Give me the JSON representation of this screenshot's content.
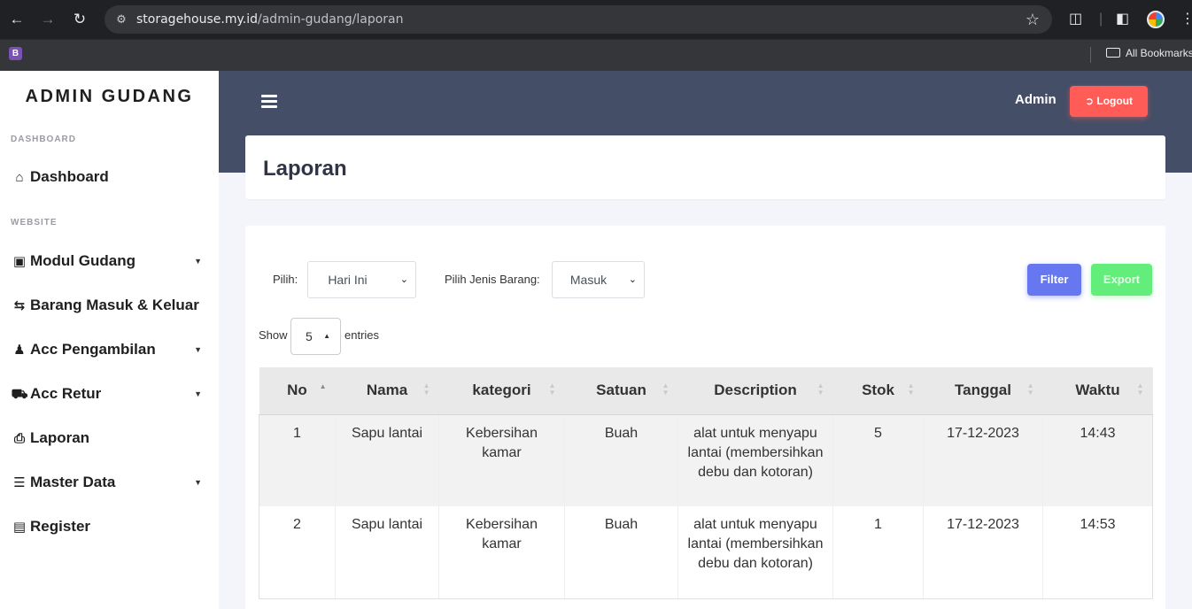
{
  "browser": {
    "url_host": "storagehouse.my.id",
    "url_path": "/admin-gudang/laporan",
    "bookmarks_label": "All Bookmarks",
    "favicon_letter": "B"
  },
  "sidebar": {
    "brand": "ADMIN GUDANG",
    "sections": {
      "dashboard": "DASHBOARD",
      "website": "WEBSITE"
    },
    "items": [
      {
        "label": "Dashboard",
        "icon": "home-icon"
      },
      {
        "label": "Modul Gudang",
        "icon": "boxes-icon",
        "has_caret": true
      },
      {
        "label": "Barang Masuk & Keluar",
        "icon": "exchange-icon"
      },
      {
        "label": "Acc Pengambilan",
        "icon": "people-carry-icon",
        "has_caret": true
      },
      {
        "label": "Acc Retur",
        "icon": "dolly-icon",
        "has_caret": true
      },
      {
        "label": "Laporan",
        "icon": "print-icon"
      },
      {
        "label": "Master Data",
        "icon": "database-icon",
        "has_caret": true
      },
      {
        "label": "Register",
        "icon": "id-card-icon"
      }
    ]
  },
  "header": {
    "user": "Admin",
    "logout_label": "Logout"
  },
  "page": {
    "title": "Laporan"
  },
  "filters": {
    "pilih_label": "Pilih:",
    "pilih_value": "Hari Ini",
    "jenis_label": "Pilih Jenis Barang:",
    "jenis_value": "Masuk",
    "filter_button": "Filter",
    "export_button": "Export"
  },
  "entries": {
    "show_label": "Show",
    "value": "5",
    "entries_label": "entries"
  },
  "table": {
    "columns": [
      "No",
      "Nama",
      "kategori",
      "Satuan",
      "Description",
      "Stok",
      "Tanggal",
      "Waktu"
    ],
    "rows": [
      [
        "1",
        "Sapu lantai",
        "Kebersihan kamar",
        "Buah",
        "alat untuk menyapu lantai (membersihkan debu dan kotoran)",
        "5",
        "17-12-2023",
        "14:43"
      ],
      [
        "2",
        "Sapu lantai",
        "Kebersihan kamar",
        "Buah",
        "alat untuk menyapu lantai (membersihkan debu dan kotoran)",
        "1",
        "17-12-2023",
        "14:53"
      ]
    ]
  },
  "colors": {
    "header_band": "#444e67",
    "logout": "#ff5b57",
    "filter": "#6777ef",
    "export": "#63ed7a"
  }
}
